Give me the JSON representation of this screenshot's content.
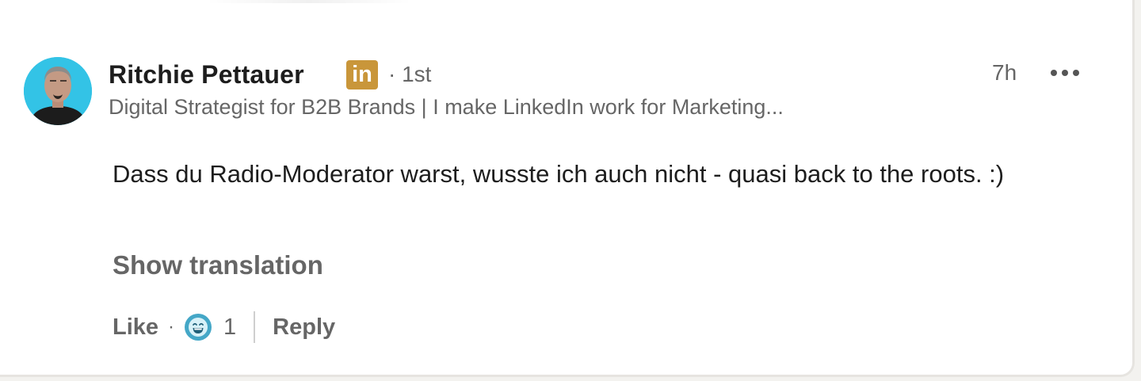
{
  "comment": {
    "author": {
      "name": "Ritchie Pettauer",
      "badge_icon": "linkedin-premium-icon",
      "badge_text": "in",
      "degree": "· 1st",
      "headline": "Digital Strategist for B2B Brands | I make LinkedIn work for Marketing..."
    },
    "timestamp": "7h",
    "more_icon": "more-horizontal-icon",
    "text": "Dass du Radio-Moderator warst, wusste ich auch nicht - quasi back to the roots. :)",
    "show_translation_label": "Show translation",
    "actions": {
      "like_label": "Like",
      "separator": "·",
      "reaction_icon": "funny-reaction-icon",
      "reaction_count": "1",
      "reply_label": "Reply"
    }
  },
  "colors": {
    "text_primary": "#1d1d1d",
    "text_secondary": "#666666",
    "premium_badge": "#c9963a",
    "reaction_blue": "#44a7c7",
    "avatar_background": "#33c3e6"
  }
}
